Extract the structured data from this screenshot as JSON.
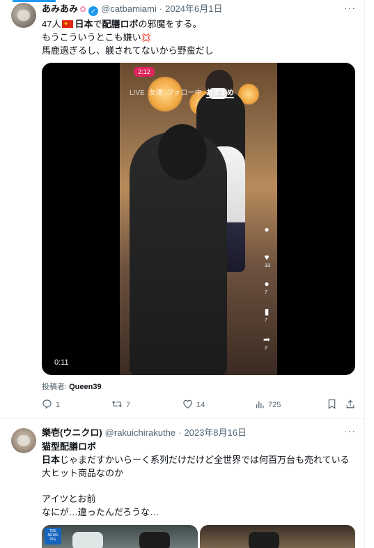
{
  "post1": {
    "author_name": "あみあみ",
    "handle": "@catbamiami",
    "date": "2024年6月1日",
    "lines": {
      "l1_prefix": "47人",
      "l1_bold1": "日本",
      "l1_mid": "で",
      "l1_bold2": "配膳ロボ",
      "l1_suffix": "の邪魔をする。",
      "l2": "もうこういうとこも嫌い",
      "l3": "馬鹿過ぎるし、躾されてないから野蛮だし"
    },
    "video": {
      "status_time": "2:12",
      "live_label": "LIVE",
      "tabs": [
        "友達",
        "フォロー中",
        "おすすめ"
      ],
      "active_tab": "おすすめ",
      "duration": "0:11",
      "side_counts": [
        "33",
        "7",
        "7",
        "2"
      ]
    },
    "credit_label": "投稿者: ",
    "credit_name": "Queen39",
    "metrics": {
      "replies": "1",
      "reposts": "7",
      "likes": "14",
      "views": "725"
    }
  },
  "post2": {
    "author_name": "樂壱(ウニクロ)",
    "handle": "@rakuichirakuthe",
    "date": "2023年8月16日",
    "lines": {
      "l1": "猫型配膳ロボ",
      "l2_bold": "日本",
      "l2_rest": "じゃまだすかいらーく系列だけだけど全世界では何百万台も売れている",
      "l3": "大ヒット商品なのか",
      "l4": "アイツとお前",
      "l5": "なにが…違ったんだろうな…"
    },
    "thumb_badge": "TBS NEWS DIG"
  },
  "colors": {
    "accent": "#1d9bf0",
    "secondary_text": "#536471",
    "text": "#0f1419"
  }
}
